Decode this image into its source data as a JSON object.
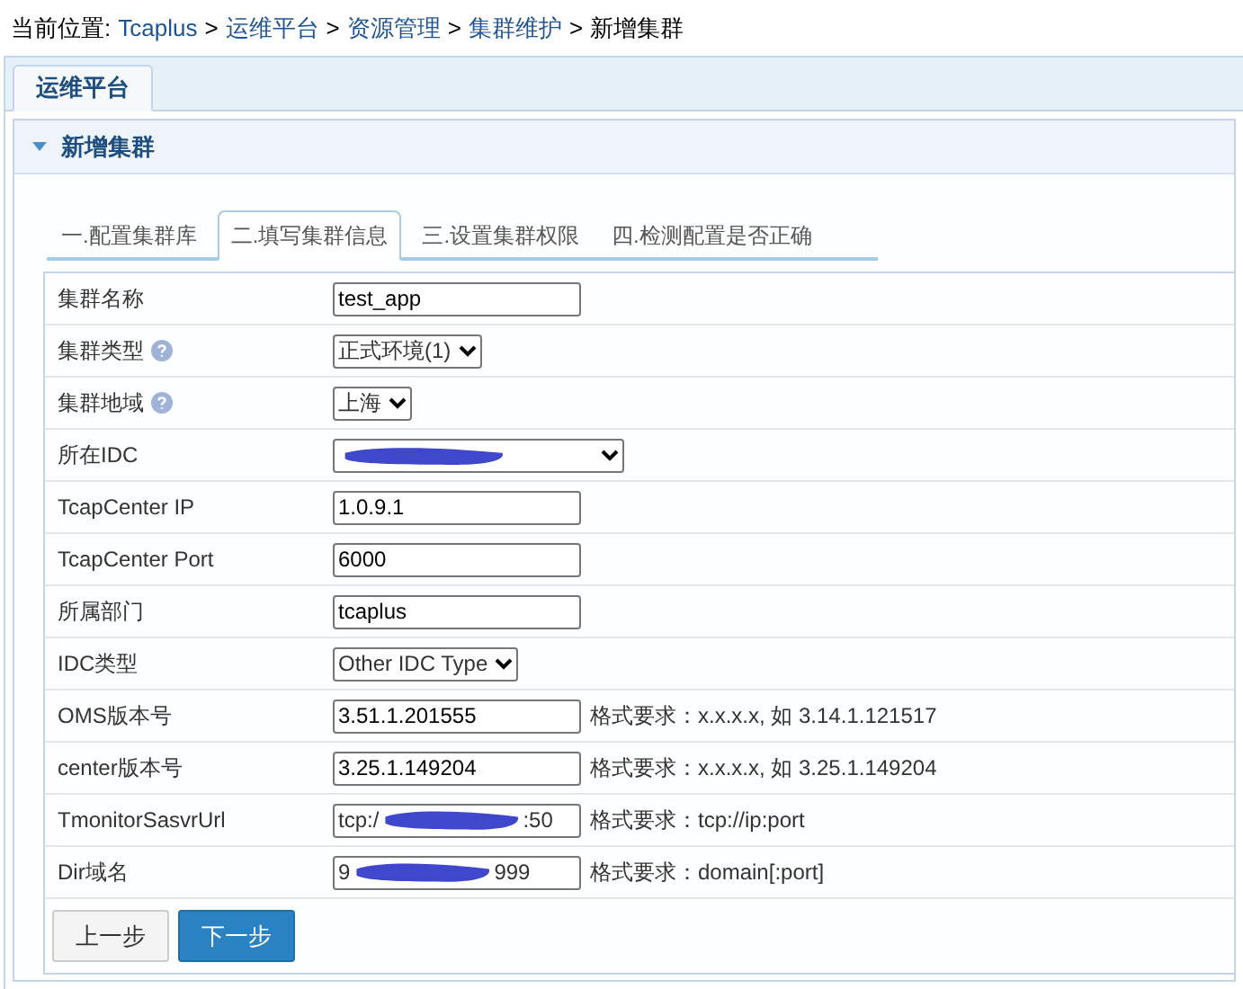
{
  "breadcrumb": {
    "label": "当前位置:",
    "links": [
      "Tcaplus",
      "运维平台",
      "资源管理",
      "集群维护"
    ],
    "current": "新增集群",
    "separator": ">"
  },
  "top_tabs": [
    {
      "label": "运维平台",
      "selected": true
    }
  ],
  "panel": {
    "title": "新增集群",
    "expanded": true
  },
  "steps": [
    {
      "label": "一.配置集群库",
      "selected": false
    },
    {
      "label": "二.填写集群信息",
      "selected": true
    },
    {
      "label": "三.设置集群权限",
      "selected": false
    },
    {
      "label": "四.检测配置是否正确",
      "selected": false
    }
  ],
  "fields": [
    {
      "label": "集群名称",
      "kind": "text",
      "value": "test_app"
    },
    {
      "label": "集群类型",
      "kind": "select",
      "value": "正式环境(1)",
      "help": true
    },
    {
      "label": "集群地域",
      "kind": "select",
      "value": "上海",
      "help": true
    },
    {
      "label": "所在IDC",
      "kind": "redacted_select"
    },
    {
      "label": "TcapCenter IP",
      "kind": "text",
      "value": "1.0.9.1"
    },
    {
      "label": "TcapCenter Port",
      "kind": "text",
      "value": "6000"
    },
    {
      "label": "所属部门",
      "kind": "text",
      "value": "tcaplus"
    },
    {
      "label": "IDC类型",
      "kind": "select",
      "value": "Other IDC Type"
    },
    {
      "label": "OMS版本号",
      "kind": "text",
      "value": "3.51.1.201555",
      "hint": "格式要求：x.x.x.x, 如 3.14.1.121517"
    },
    {
      "label": "center版本号",
      "kind": "text",
      "value": "3.25.1.149204",
      "hint": "格式要求：x.x.x.x, 如 3.25.1.149204"
    },
    {
      "label": "TmonitorSasvrUrl",
      "kind": "redacted_text",
      "prefix": "tcp:/",
      "suffix": ":50",
      "hint": "格式要求：tcp://ip:port"
    },
    {
      "label": "Dir域名",
      "kind": "redacted_text",
      "prefix": "9",
      "suffix": "999",
      "hint": "格式要求：domain[:port]"
    }
  ],
  "buttons": [
    {
      "label": "上一步",
      "kind": "secondary"
    },
    {
      "label": "下一步",
      "kind": "primary"
    }
  ]
}
